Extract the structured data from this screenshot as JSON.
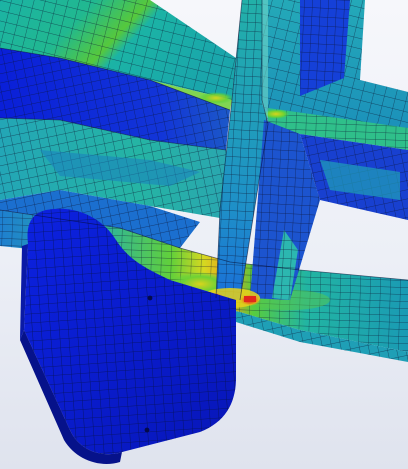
{
  "viewport": {
    "background_top": "#f6f7fb",
    "background_bottom": "#dfe3ee"
  },
  "stress_colors": {
    "low": "#0a1fd8",
    "low_mid": "#1f5fe0",
    "mid": "#1bb3a5",
    "mid_high": "#3fd24a",
    "high": "#e8d21a",
    "max": "#e0281c"
  },
  "mesh_line_color": "#0b1230",
  "parts": [
    {
      "name": "main-beam",
      "stress": "mid"
    },
    {
      "name": "diagonal-plate",
      "stress": "mid"
    },
    {
      "name": "lower-flange",
      "stress": "mid-high"
    },
    {
      "name": "vertical-web",
      "stress": "mid"
    },
    {
      "name": "side-gusset",
      "stress": "low"
    },
    {
      "name": "bracket",
      "stress": "low"
    },
    {
      "name": "hot-spot",
      "stress": "max"
    }
  ]
}
